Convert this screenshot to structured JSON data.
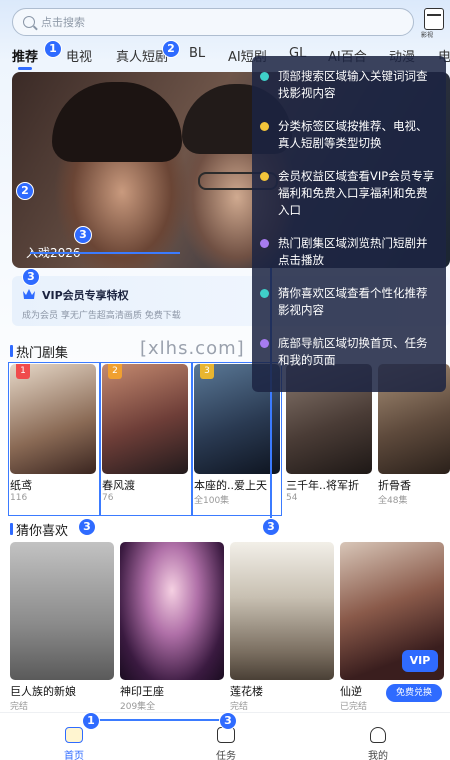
{
  "search": {
    "placeholder": "点击搜索"
  },
  "top_icon": {
    "label": "影视"
  },
  "tabs": [
    {
      "label": "推荐",
      "active": true
    },
    {
      "label": "电视"
    },
    {
      "label": "真人短剧"
    },
    {
      "label": "BL"
    },
    {
      "label": "AI短剧"
    },
    {
      "label": "GL"
    },
    {
      "label": "AI百合"
    },
    {
      "label": "动漫"
    },
    {
      "label": "电"
    }
  ],
  "banner": {
    "title": "入戏2026"
  },
  "vip": {
    "title": "VIP会员专享特权",
    "desc": "成为会员 享无广告超高清画质 免费下载"
  },
  "hot_section": {
    "title": "热门剧集",
    "items": [
      {
        "name": "纸鸢",
        "sub": "116",
        "rank": "1",
        "rank_color": "#f04b4b",
        "color_a": "#d9c9b8",
        "color_b": "#5b3b2e"
      },
      {
        "name": "春风渡",
        "sub": "76",
        "rank": "2",
        "rank_color": "#f0a030",
        "color_a": "#a8665a",
        "color_b": "#2e2326"
      },
      {
        "name": "本座的..爱上天",
        "sub": "全100集",
        "rank": "3",
        "rank_color": "#e8b530",
        "color_a": "#3e5670",
        "color_b": "#121a28"
      },
      {
        "name": "三千年..将军折",
        "sub": "54",
        "rank": "",
        "rank_color": "",
        "color_a": "#6a5a52",
        "color_b": "#26201f"
      },
      {
        "name": "折骨香",
        "sub": "全48集",
        "rank": "",
        "rank_color": "",
        "color_a": "#8b7662",
        "color_b": "#3a2c24"
      }
    ]
  },
  "like_section": {
    "title": "猜你喜欢",
    "items": [
      {
        "name": "巨人族的新娘",
        "sub": "完结",
        "color_a": "#b3b3b3",
        "color_b": "#6a6a6a"
      },
      {
        "name": "神印王座",
        "sub": "209集全",
        "color_a": "#f0c2d8",
        "color_b": "#2a1430"
      },
      {
        "name": "莲花楼",
        "sub": "完结",
        "color_a": "#e9e4da",
        "color_b": "#6a5f50"
      },
      {
        "name": "仙逆",
        "sub": "已完结",
        "color_a": "#c9b5a8",
        "color_b": "#3a1e1e"
      }
    ],
    "vip_badge": "VIP",
    "redeem_label": "免费兑换"
  },
  "nav": [
    {
      "label": "首页",
      "icon": "home-icon",
      "active": true
    },
    {
      "label": "任务",
      "icon": "task-icon"
    },
    {
      "label": "我的",
      "icon": "profile-icon"
    }
  ],
  "tips": [
    {
      "text": "顶部搜索区域输入关键词词查找影视内容",
      "dot": "#3fd0c9"
    },
    {
      "text": "分类标签区域按推荐、电视、真人短剧等类型切换",
      "dot": "#f2c43a"
    },
    {
      "text": "会员权益区域查看VIP会员专享福利和免费入口享福利和免费入口",
      "dot": "#f2c43a"
    },
    {
      "text": "热门剧集区域浏览热门短剧并点击播放",
      "dot": "#a77cf0"
    },
    {
      "text": "猜你喜欢区域查看个性化推荐影视内容",
      "dot": "#3fd0c9"
    },
    {
      "text": "底部导航区域切换首页、任务和我的页面",
      "dot": "#a77cf0"
    }
  ],
  "markers": [
    "1",
    "2",
    "2",
    "3",
    "3",
    "3",
    "3",
    "1",
    "3"
  ],
  "watermark": "[xlhs.com]"
}
